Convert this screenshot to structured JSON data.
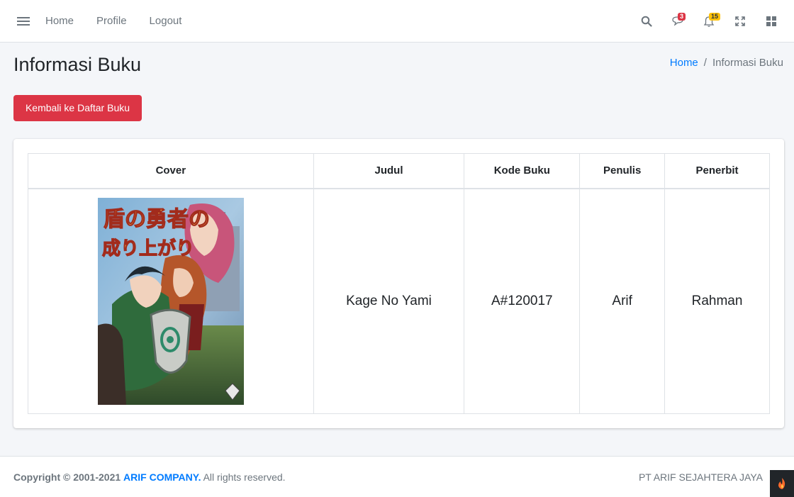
{
  "navbar": {
    "links": [
      "Home",
      "Profile",
      "Logout"
    ],
    "messages_badge": "3",
    "notifications_badge": "15"
  },
  "header": {
    "title": "Informasi Buku",
    "breadcrumb": {
      "home": "Home",
      "separator": "/",
      "current": "Informasi Buku"
    }
  },
  "actions": {
    "back_label": "Kembali ke Daftar Buku"
  },
  "table": {
    "headers": [
      "Cover",
      "Judul",
      "Kode Buku",
      "Penulis",
      "Penerbit"
    ],
    "row": {
      "judul": "Kage No Yami",
      "kode": "A#120017",
      "penulis": "Arif",
      "penerbit": "Rahman"
    },
    "cover_title_line1": "盾の勇者の",
    "cover_title_line2": "成り上がり"
  },
  "footer": {
    "copyright_prefix": "Copyright © 2001-2021",
    "company": "ARIF COMPANY.",
    "rights": "All rights reserved.",
    "right_text": "PT ARIF SEJAHTERA JAYA"
  },
  "colors": {
    "danger": "#dc3545",
    "primary": "#007bff",
    "warning": "#ffc107"
  }
}
